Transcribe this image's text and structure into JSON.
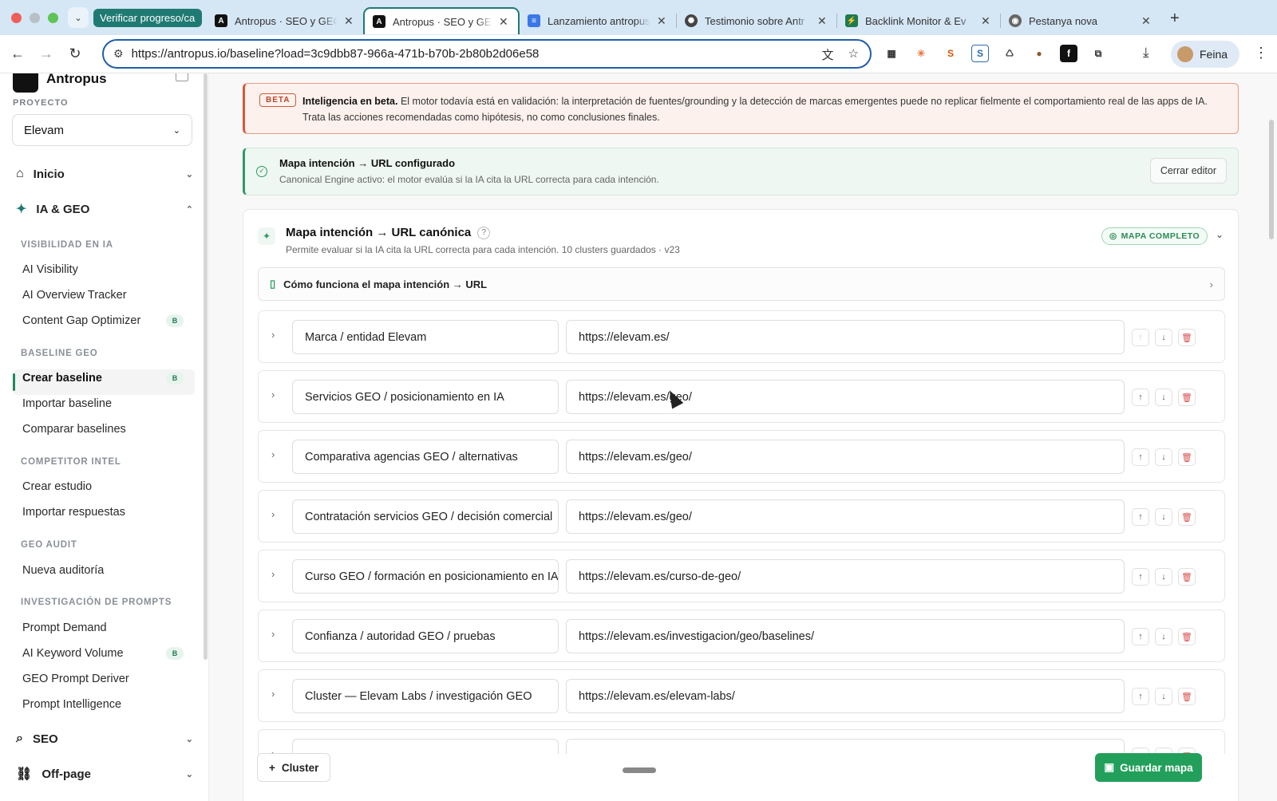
{
  "browser": {
    "group_chip": "Verificar progreso/ca",
    "tabs": [
      {
        "title": "Antropus · SEO y GEO"
      },
      {
        "title": "Antropus · SEO y GEO"
      },
      {
        "title": "Lanzamiento antropus"
      },
      {
        "title": "Testimonio sobre Antr"
      },
      {
        "title": "Backlink Monitor & Ev"
      },
      {
        "title": "Pestanya nova"
      }
    ],
    "url": "https://antropus.io/baseline?load=3c9dbb87-966a-471b-b70b-2b80b2d06e58",
    "profile_label": "Feina"
  },
  "sidebar": {
    "brand": "Antropus",
    "project_label": "PROYECTO",
    "project_value": "Elevam",
    "inicio": "Inicio",
    "ia_geo": "IA & GEO",
    "sec_visibilidad": "VISIBILIDAD EN IA",
    "ai_visibility": "AI Visibility",
    "ai_overview": "AI Overview Tracker",
    "content_gap": "Content Gap Optimizer",
    "sec_baseline": "BASELINE GEO",
    "crear_baseline": "Crear baseline",
    "importar_baseline": "Importar baseline",
    "comparar_baselines": "Comparar baselines",
    "sec_competitor": "COMPETITOR INTEL",
    "crear_estudio": "Crear estudio",
    "importar_respuestas": "Importar respuestas",
    "sec_audit": "GEO AUDIT",
    "nueva_auditoria": "Nueva auditoría",
    "sec_prompts": "INVESTIGACIÓN DE PROMPTS",
    "prompt_demand": "Prompt Demand",
    "ai_keyword": "AI Keyword Volume",
    "prompt_deriver": "GEO Prompt Deriver",
    "prompt_intel": "Prompt Intelligence",
    "seo": "SEO",
    "offpage": "Off-page",
    "badge": "B"
  },
  "beta": {
    "chip": "BETA",
    "bold": "Inteligencia en beta.",
    "text": " El motor todavía está en validación: la interpretación de fuentes/grounding y la detección de marcas emergentes puede no replicar fielmente el comportamiento real de las apps de IA. Trata las acciones recomendadas como hipótesis, no como conclusiones finales."
  },
  "configured": {
    "title": "Mapa intención → URL configurado",
    "subtitle": "Canonical Engine activo: el motor evalúa si la IA cita la URL correcta para cada intención.",
    "close_button": "Cerrar editor"
  },
  "card": {
    "title": "Mapa intención → URL canónica",
    "help": "?",
    "subtitle": "Permite evaluar si la IA cita la URL correcta para cada intención. 10 clusters guardados · v23",
    "status_badge": "MAPA COMPLETO",
    "howto": "Cómo funciona el mapa intención → URL",
    "add_cluster": "Cluster",
    "save": "Guardar mapa"
  },
  "clusters": [
    {
      "name": "Marca / entidad Elevam",
      "url": "https://elevam.es/"
    },
    {
      "name": "Servicios GEO / posicionamiento en IA",
      "url": "https://elevam.es/geo/"
    },
    {
      "name": "Comparativa agencias GEO / alternativas",
      "url": "https://elevam.es/geo/"
    },
    {
      "name": "Contratación servicios GEO / decisión comercial",
      "url": "https://elevam.es/geo/"
    },
    {
      "name": "Curso GEO / formación en posicionamiento en IA",
      "url": "https://elevam.es/curso-de-geo/"
    },
    {
      "name": "Confianza / autoridad GEO / pruebas",
      "url": "https://elevam.es/investigacion/geo/baselines/"
    },
    {
      "name": "Cluster — Elevam Labs / investigación GEO",
      "url": "https://elevam.es/elevam-labs/"
    },
    {
      "name": "",
      "url": ""
    }
  ]
}
